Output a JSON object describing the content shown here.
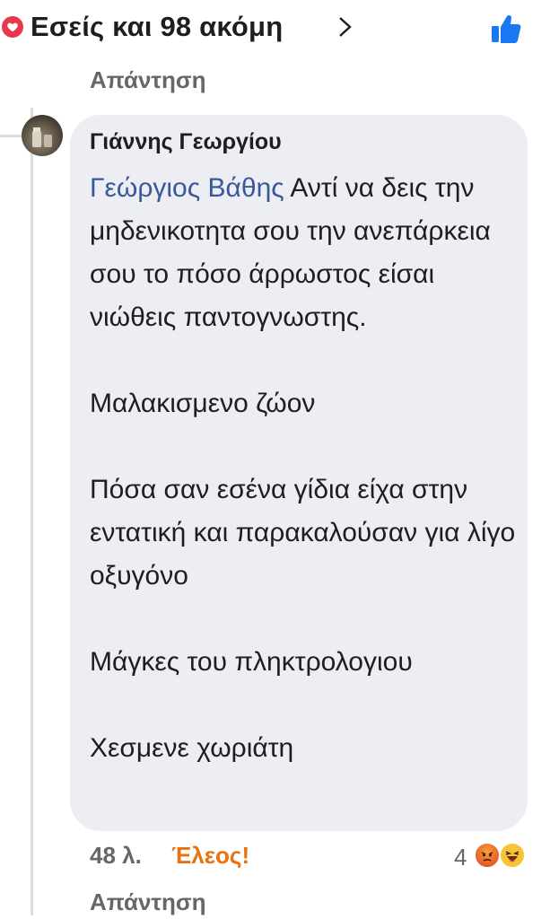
{
  "reactions_header": {
    "summary": "Εσείς και 98 ακόμη",
    "heart_color": "#e8384f",
    "like_color": "#1877f2"
  },
  "reply_top_label": "Απάντηση",
  "comment": {
    "author": "Γιάννης Γεωργίου",
    "mention": "Γεώργιος Βάθης",
    "text": " Αντί να δεις την μηδενικοτητα σου την ανεπάρκεια σου το πόσο άρρωστος είσαι νιώθεις παντογνωστης.\n\nΜαλακισμενο ζώον\n\nΠόσα σαν εσένα γίδια είχα στην εντατική και παρακαλούσαν για λίγο οξυγόνο\n\nΜάγκες του πληκτρολογιου\n\nΧεσμενε χωριάτη",
    "time": "48 λ.",
    "reaction_label": "Έλεος!",
    "reaction_count": "4",
    "reaction_icons": [
      "angry-icon",
      "haha-icon"
    ]
  },
  "reply_bottom_label": "Απάντηση"
}
